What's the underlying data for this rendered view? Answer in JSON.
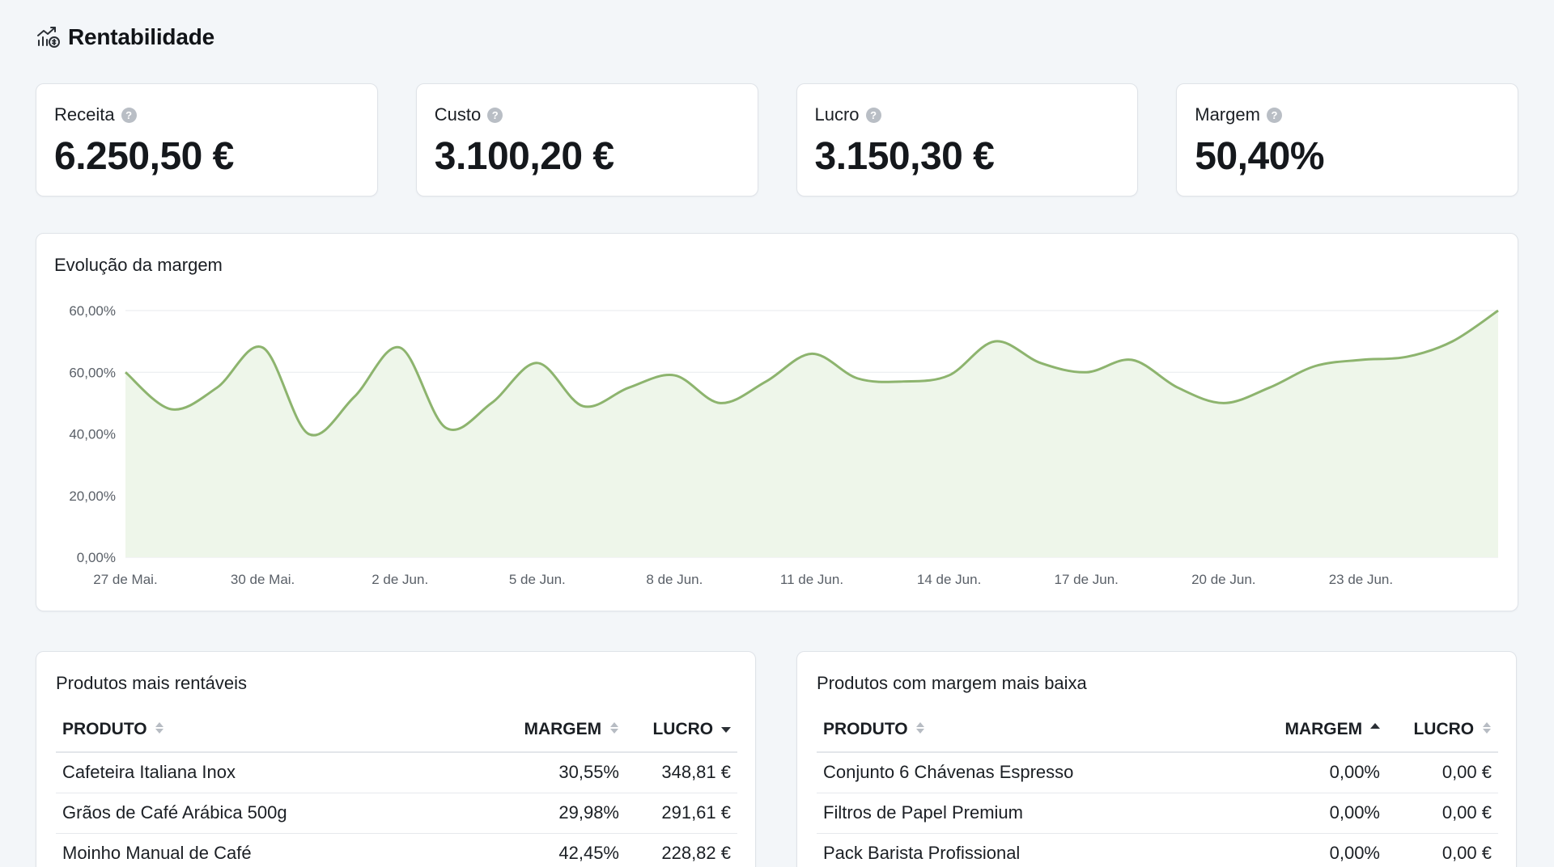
{
  "header": {
    "title": "Rentabilidade",
    "icon": "chart-coin-icon"
  },
  "kpis": [
    {
      "label": "Receita",
      "value": "6.250,50 €"
    },
    {
      "label": "Custo",
      "value": "3.100,20 €"
    },
    {
      "label": "Lucro",
      "value": "3.150,30 €"
    },
    {
      "label": "Margem",
      "value": "50,40%"
    }
  ],
  "chart": {
    "title": "Evolução da margem"
  },
  "chart_data": {
    "type": "area",
    "title": "Evolução da margem",
    "y_tick_labels": [
      "60,00%",
      "60,00%",
      "40,00%",
      "20,00%",
      "0,00%"
    ],
    "x_tick_labels": [
      "27 de Mai.",
      "30 de Mai.",
      "2 de Jun.",
      "5 de Jun.",
      "8 de Jun.",
      "11 de Jun.",
      "14 de Jun.",
      "17 de Jun.",
      "20 de Jun.",
      "23 de Jun."
    ],
    "x_tick_dates": [
      "2024-05-27",
      "2024-05-30",
      "2024-06-02",
      "2024-06-05",
      "2024-06-08",
      "2024-06-11",
      "2024-06-14",
      "2024-06-17",
      "2024-06-20",
      "2024-06-23"
    ],
    "x": [
      "2024-05-27",
      "2024-05-28",
      "2024-05-29",
      "2024-05-30",
      "2024-05-31",
      "2024-06-01",
      "2024-06-02",
      "2024-06-03",
      "2024-06-04",
      "2024-06-05",
      "2024-06-06",
      "2024-06-07",
      "2024-06-08",
      "2024-06-09",
      "2024-06-10",
      "2024-06-11",
      "2024-06-12",
      "2024-06-13",
      "2024-06-14",
      "2024-06-15",
      "2024-06-16",
      "2024-06-17",
      "2024-06-18",
      "2024-06-19",
      "2024-06-20",
      "2024-06-21",
      "2024-06-22",
      "2024-06-23",
      "2024-06-24",
      "2024-06-25",
      "2024-06-26"
    ],
    "y": [
      60.0,
      48.0,
      55.0,
      68.0,
      40.0,
      52.0,
      68.0,
      42.0,
      50.0,
      63.0,
      49.0,
      55.0,
      59.0,
      50.0,
      57.0,
      66.0,
      58.0,
      57.0,
      59.0,
      70.0,
      63.0,
      60.0,
      64.0,
      55.0,
      50.0,
      55.0,
      62.0,
      64.0,
      65.0,
      70.0,
      80.0
    ],
    "ylim": [
      0,
      80
    ],
    "series_color": "#8db46e",
    "fill_color": "#eef6ea",
    "grid": true
  },
  "left_table": {
    "title": "Produtos mais rentáveis",
    "columns": [
      "PRODUTO",
      "MARGEM",
      "LUCRO"
    ],
    "rows": [
      [
        "Cafeteira Italiana Inox",
        "30,55%",
        "348,81 €"
      ],
      [
        "Grãos de Café Arábica 500g",
        "29,98%",
        "291,61 €"
      ],
      [
        "Moinho Manual de Café",
        "42,45%",
        "228,82 €"
      ]
    ]
  },
  "right_table": {
    "title": "Produtos com margem mais baixa",
    "columns": [
      "PRODUTO",
      "MARGEM",
      "LUCRO"
    ],
    "rows": [
      [
        "Conjunto 6 Chávenas Espresso",
        "0,00%",
        "0,00 €"
      ],
      [
        "Filtros de Papel Premium",
        "0,00%",
        "0,00 €"
      ],
      [
        "Pack Barista Profissional",
        "0,00%",
        "0,00 €"
      ]
    ]
  }
}
